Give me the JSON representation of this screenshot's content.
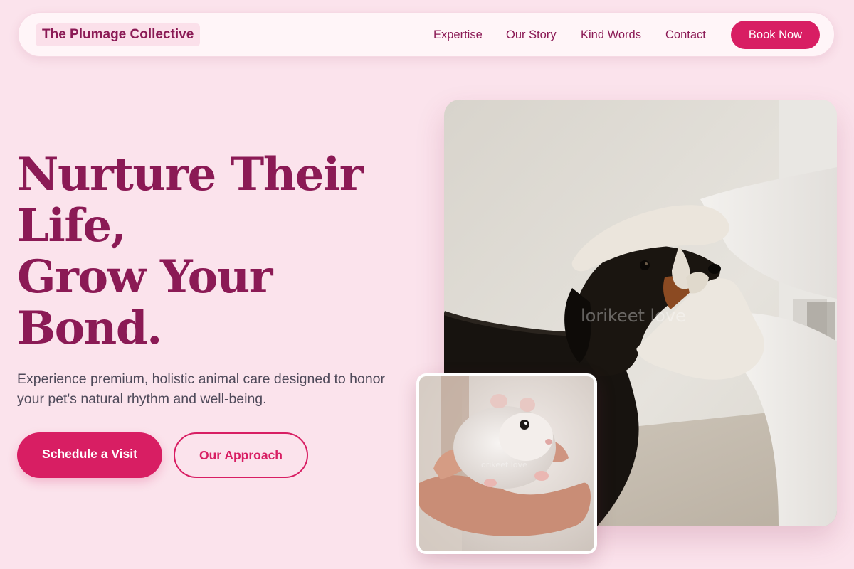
{
  "nav": {
    "brand": "The Plumage Collective",
    "links": [
      "Expertise",
      "Our Story",
      "Kind Words",
      "Contact"
    ],
    "cta": "Book Now"
  },
  "hero": {
    "title_lines": [
      "Nurture Their",
      "Life,",
      "Grow Your",
      "Bond."
    ],
    "subtitle": "Experience premium, holistic animal care designed to honor your pet's natural rhythm and well-being.",
    "primary_button": "Schedule a Visit",
    "secondary_button": "Our Approach"
  },
  "images": {
    "main_watermark": "lorikeet love",
    "inset_watermark": "lorikeet love"
  },
  "colors": {
    "background": "#fbe3ec",
    "brand_text": "#8b1a55",
    "accent": "#d81e63",
    "body_text": "#4f4a5a"
  }
}
